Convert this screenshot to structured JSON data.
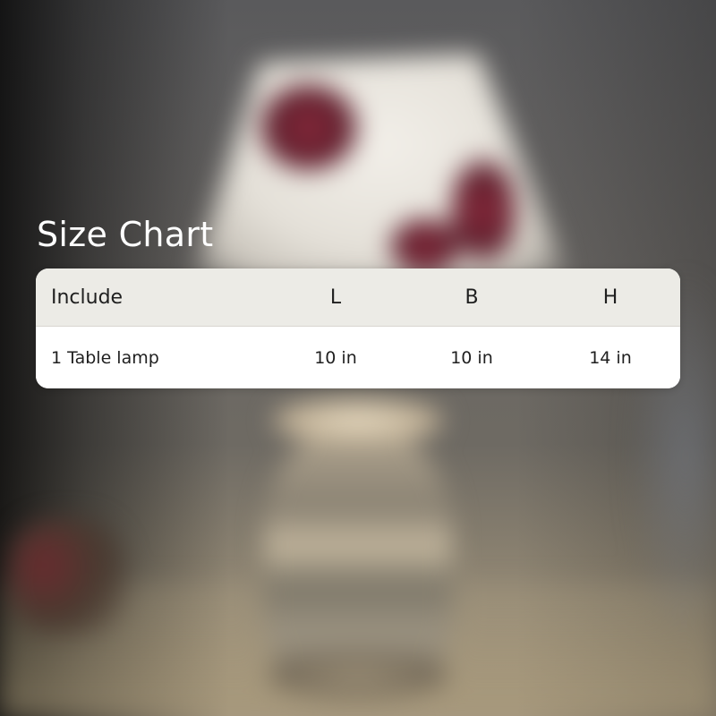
{
  "title": "Size Chart",
  "table": {
    "headers": [
      "Include",
      "L",
      "B",
      "H"
    ],
    "rows": [
      [
        "1 Table lamp",
        "10 in",
        "10 in",
        "14 in"
      ]
    ]
  }
}
